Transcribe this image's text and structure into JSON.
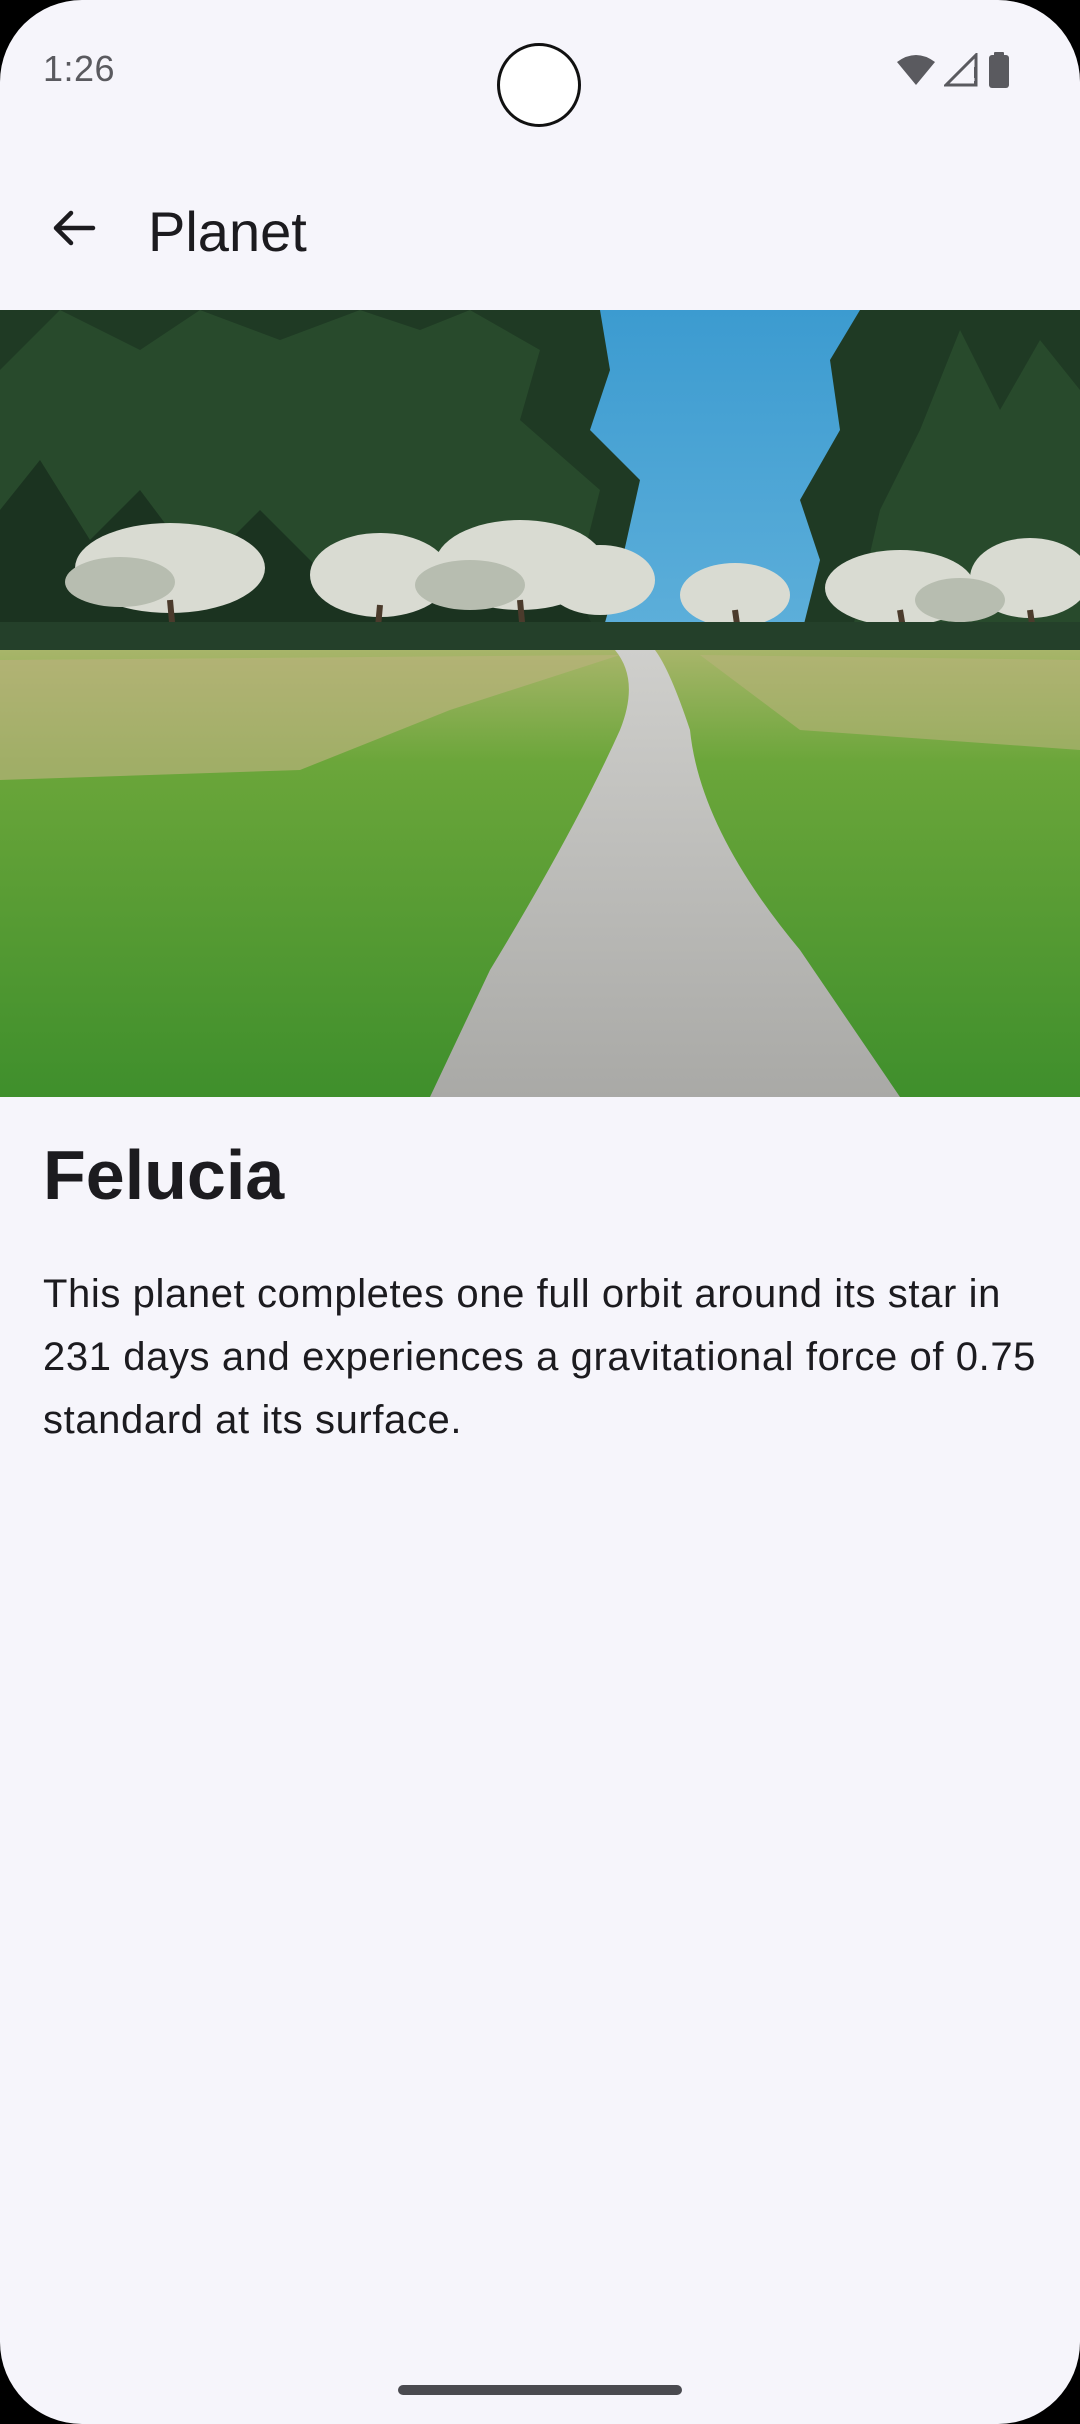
{
  "status_bar": {
    "time": "1:26",
    "icons": [
      "wifi-icon",
      "cell-signal-icon",
      "battery-icon"
    ]
  },
  "app_bar": {
    "back_icon": "arrow-left-icon",
    "title": "Planet"
  },
  "hero_image": {
    "subject": "grassy meadow with gravel path leading through trees"
  },
  "planet": {
    "name": "Felucia",
    "description": "This planet completes one full orbit around its star in 231 days and experiences a gravitational force of 0.75 standard at its surface."
  },
  "colors": {
    "background": "#f6f5fb",
    "text_primary": "#1c1b1f",
    "status_text": "#5a5a5f"
  }
}
